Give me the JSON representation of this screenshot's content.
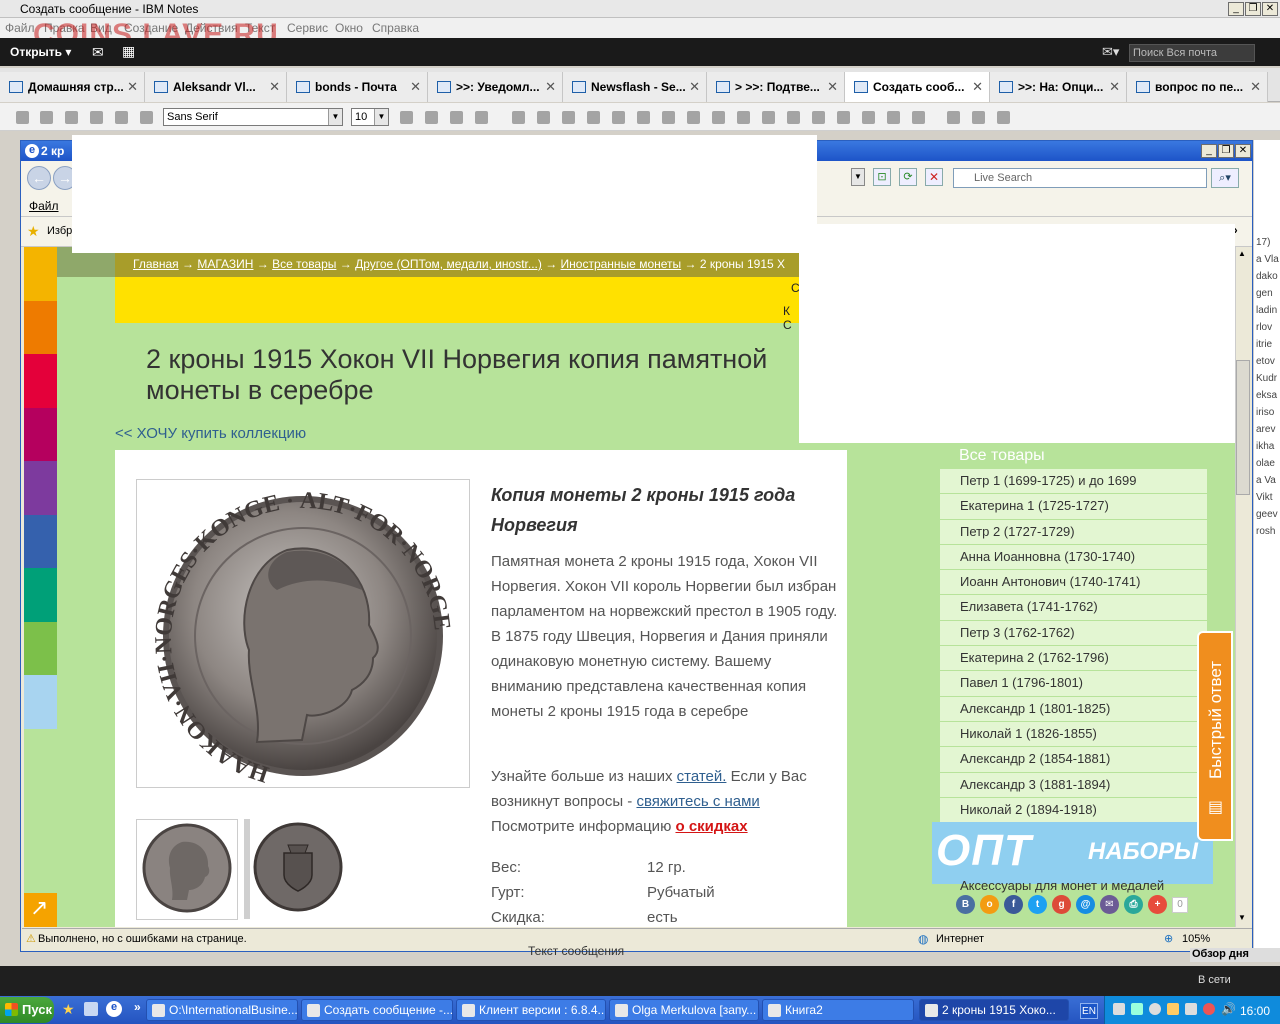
{
  "app": {
    "title": "Создать сообщение - IBM Notes",
    "watermark": "COINS.LAVE.RU",
    "menu": [
      "Файл",
      "Правка",
      "Вид",
      "Создание",
      "Действия",
      "Текст",
      "Сервис",
      "Окно",
      "Справка"
    ],
    "open_label": "Открыть",
    "search_placeholder": "Поиск Вся почта"
  },
  "tabs": [
    {
      "label": "Домашняя стр...",
      "active": false
    },
    {
      "label": "Aleksandr Vl...",
      "active": false
    },
    {
      "label": "bonds - Почта",
      "active": false
    },
    {
      "label": ">>: Уведомл...",
      "active": false
    },
    {
      "label": "Newsflash - Se...",
      "active": false
    },
    {
      "label": "> >>: Подтве...",
      "active": false
    },
    {
      "label": "Создать сооб...",
      "active": true
    },
    {
      "label": ">>: На: Опци...",
      "active": false
    },
    {
      "label": "вопрос по пе...",
      "active": false
    }
  ],
  "format": {
    "font": "Sans Serif",
    "size": "10"
  },
  "browser": {
    "title": "2 кр",
    "file_menu": "Файл",
    "favorites": "Избр",
    "live_search": "Live Search",
    "status": "Выполнено, но с ошибками на странице.",
    "zone": "Интернет",
    "zoom": "105%"
  },
  "site": {
    "breadcrumb": {
      "links": [
        "Главная",
        "МАГАЗИН",
        "Все товары",
        "Другое (ОПТом, медали, инostr...)",
        "Иностранные монеты"
      ],
      "current": "2 кроны 1915 Х"
    },
    "yellow_line1": "С",
    "yellow_line2": "К С",
    "title": "2 кроны 1915 Хокон VII Норвегия копия памятной монеты в серебре",
    "back_link": "<< ХОЧУ купить коллекцию",
    "subtitle": "Копия монеты 2 кроны 1915 года Норвегия",
    "description": "Памятная монета 2 кроны 1915 года, Хокон VII Норвегия. Хокон VII король Норвегии был избран парламентом на норвежский престол в 1905 году. В 1875 году Швеция, Норвегия и Дания приняли одинаковую монетную систему. Вашему вниманию представлена качественная копия монеты 2 кроны 1915 года в серебре",
    "more": {
      "t1": "Узнайте больше из наших ",
      "l1": "статей.",
      "t2": "  Если у Вас возникнут вопросы -  ",
      "l2": "свяжитесь с нами",
      "t3": "  Посмотрите информацию  ",
      "l3": "о скидках"
    },
    "specs": [
      {
        "label": "Вес:",
        "value": "12 гр."
      },
      {
        "label": "Гурт:",
        "value": "Рубчатый"
      },
      {
        "label": "Скидка:",
        "value": "есть"
      }
    ],
    "coin_obverse_text": "HAAKON·VII·NORGES·KONGE · ALT·FOR·NORGE",
    "sidebar_header": "Все товары",
    "sidebar_items": [
      "Петр 1 (1699-1725) и до 1699",
      "Екатерина 1 (1725-1727)",
      "Петр 2 (1727-1729)",
      "Анна Иоанновна (1730-1740)",
      "Иоанн Антонович (1740-1741)",
      "Елизавета (1741-1762)",
      "Петр 3 (1762-1762)",
      "Екатерина 2 (1762-1796)",
      "Павел 1 (1796-1801)",
      "Александр 1 (1801-1825)",
      "Николай 1 (1826-1855)",
      "Александр 2 (1854-1881)",
      "Александр 3 (1881-1894)",
      "Николай 2 (1894-1918)"
    ],
    "opt_big": "ОПТ",
    "opt_small": "НАБОРЫ",
    "accessories": "Аксессуары для монет и медалей",
    "social_count": "0",
    "quick_reply": "Быстрый ответ"
  },
  "notes_bottom": {
    "message_text": "Текст сообщения",
    "online": "В сети",
    "overview": "Обзор дня"
  },
  "right_names": [
    "17)",
    "a Vla",
    "dako",
    "gen",
    "ladin",
    "rlov",
    "itrie",
    "etov",
    "Kudr",
    "eksa",
    "iriso",
    "arev",
    "ikha",
    "olae",
    "a Va",
    "Vikt",
    "geev",
    "rosh"
  ],
  "taskbar": {
    "start": "Пуск",
    "tasks": [
      {
        "label": "O:\\InternationalBusine...",
        "active": false
      },
      {
        "label": "Создать сообщение -...",
        "active": false
      },
      {
        "label": "Клиент версии : 6.8.4...",
        "active": false
      },
      {
        "label": "Olga Merkulova [запу...",
        "active": false
      },
      {
        "label": "Книга2",
        "active": false
      },
      {
        "label": "2 кроны 1915 Хоко...",
        "active": true
      }
    ],
    "lang": "EN",
    "clock": "16:00"
  }
}
